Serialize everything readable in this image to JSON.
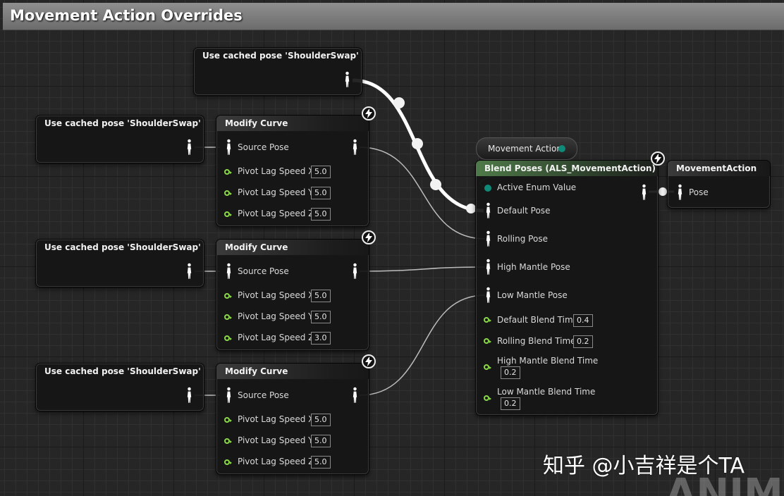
{
  "title": "Movement Action Overrides",
  "cached_poses": [
    {
      "label": "Use cached pose 'ShoulderSwap'"
    },
    {
      "label": "Use cached pose 'ShoulderSwap'"
    },
    {
      "label": "Use cached pose 'ShoulderSwap'"
    },
    {
      "label": "Use cached pose 'ShoulderSwap'"
    }
  ],
  "modify_curves": [
    {
      "title": "Modify Curve",
      "source_pose": "Source Pose",
      "pins": [
        {
          "label": "Pivot Lag Speed X",
          "value": "5.0"
        },
        {
          "label": "Pivot Lag Speed Y",
          "value": "5.0"
        },
        {
          "label": "Pivot Lag Speed Z",
          "value": "5.0"
        }
      ]
    },
    {
      "title": "Modify Curve",
      "source_pose": "Source Pose",
      "pins": [
        {
          "label": "Pivot Lag Speed X",
          "value": "5.0"
        },
        {
          "label": "Pivot Lag Speed Y",
          "value": "5.0"
        },
        {
          "label": "Pivot Lag Speed Z",
          "value": "3.0"
        }
      ]
    },
    {
      "title": "Modify Curve",
      "source_pose": "Source Pose",
      "pins": [
        {
          "label": "Pivot Lag Speed X",
          "value": "5.0"
        },
        {
          "label": "Pivot Lag Speed Y",
          "value": "5.0"
        },
        {
          "label": "Pivot Lag Speed Z",
          "value": "5.0"
        }
      ]
    }
  ],
  "movement_action_var": {
    "label": "Movement Action"
  },
  "blend": {
    "title": "Blend Poses (ALS_MovementAction)",
    "active_enum": "Active Enum Value",
    "default_pose": "Default Pose",
    "rolling_pose": "Rolling Pose",
    "high_mantle_pose": "High Mantle Pose",
    "low_mantle_pose": "Low Mantle Pose",
    "default_blend_time": {
      "label": "Default Blend Time",
      "value": "0.4"
    },
    "rolling_blend_time": {
      "label": "Rolling Blend Time",
      "value": "0.2"
    },
    "high_mantle_blend_time": {
      "label": "High Mantle Blend Time",
      "value": "0.2"
    },
    "low_mantle_blend_time": {
      "label": "Low Mantle Blend Time",
      "value": "0.2"
    }
  },
  "output": {
    "title": "MovementAction",
    "pose": "Pose"
  },
  "watermark": "知乎 @小吉祥是个TA",
  "background_text": "ANIMA",
  "icons": {
    "pose": "pose-person-icon",
    "float_pin": "float-pin-icon",
    "enum_pin": "enum-pin-icon",
    "fast_path": "fast-path-lightning-icon"
  },
  "colors": {
    "float_pin": "#8bd94a",
    "enum_pin": "#0f8a78",
    "blend_header": "#4f7a49"
  }
}
